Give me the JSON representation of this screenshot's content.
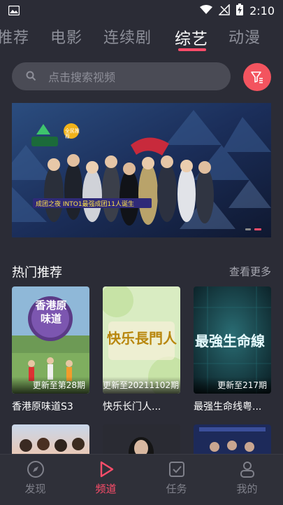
{
  "status_bar": {
    "time": "2:10"
  },
  "tabs": [
    {
      "label": "推荐"
    },
    {
      "label": "电影"
    },
    {
      "label": "连续剧"
    },
    {
      "label": "综艺"
    },
    {
      "label": "动漫"
    }
  ],
  "search": {
    "placeholder": "点击搜索视频"
  },
  "banner": {
    "top_logo": "全民推荐",
    "caption": "成团之夜 INTO1最强成团11人诞生"
  },
  "section": {
    "title": "热门推荐",
    "more": "查看更多"
  },
  "cards": [
    {
      "title": "香港原味道S3",
      "badge": "更新至第28期",
      "poster_text": "香港原味道"
    },
    {
      "title": "快乐长门人...",
      "badge": "更新至20211102期",
      "poster_text": "快乐長門人"
    },
    {
      "title": "最强生命线粤...",
      "badge": "更新至217期",
      "poster_text": "最強生命線"
    }
  ],
  "bottom_nav": [
    {
      "label": "发现"
    },
    {
      "label": "频道"
    },
    {
      "label": "任务"
    },
    {
      "label": "我的"
    }
  ],
  "colors": {
    "accent": "#ff4d6a",
    "background": "#2b2c36"
  }
}
